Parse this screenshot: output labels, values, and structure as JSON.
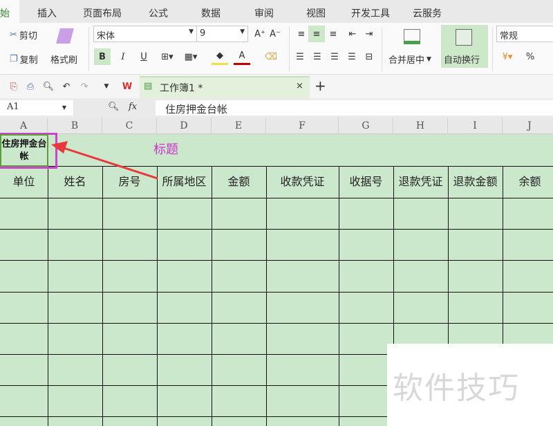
{
  "menu": {
    "tabs": [
      "始",
      "插入",
      "页面布局",
      "公式",
      "数据",
      "审阅",
      "视图",
      "开发工具",
      "云服务"
    ]
  },
  "ribbon": {
    "cut": "剪切",
    "copy": "复制",
    "format_painter": "格式刷",
    "font": "宋体",
    "font_size": "9",
    "bold": "B",
    "italic": "I",
    "underline": "U",
    "merge_center": "合并居中",
    "wrap_text": "自动换行",
    "number_format": "常规",
    "percent": "%"
  },
  "doc_tab": {
    "title": "工作簿1 *"
  },
  "formula_bar": {
    "cell_ref": "A1",
    "fx": "fx",
    "value": "住房押金台帐"
  },
  "columns": [
    "A",
    "B",
    "C",
    "D",
    "E",
    "F",
    "G",
    "H",
    "I",
    "J"
  ],
  "sheet": {
    "a1": "住房押金台帐",
    "annotation": "标题",
    "headers": [
      "单位",
      "姓名",
      "房号",
      "所属地区",
      "金额",
      "收款凭证",
      "收据号",
      "退款凭证",
      "退款金额",
      "余额"
    ]
  },
  "watermark": "软件技巧",
  "colors": {
    "cell_fill": "#cce8cc",
    "annotation": "#cc33cc",
    "arrow": "#e83a3a",
    "selection": "#5a9e3a"
  }
}
